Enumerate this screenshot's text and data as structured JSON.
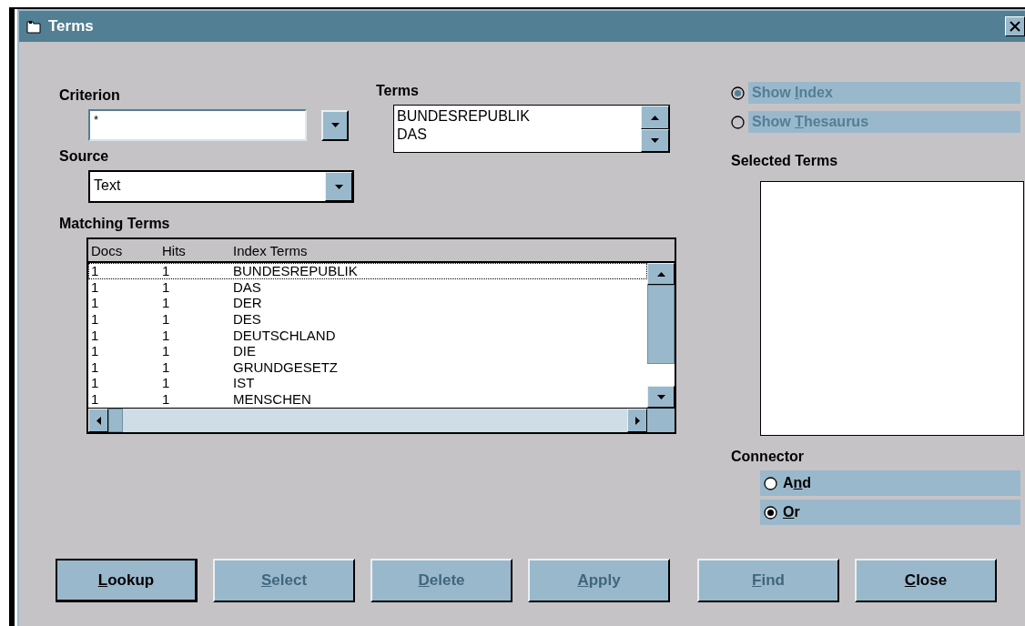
{
  "window": {
    "title": "Terms"
  },
  "criterion": {
    "label": "Criterion",
    "value": "*"
  },
  "terms": {
    "label": "Terms",
    "items": [
      "BUNDESREPUBLIK",
      "DAS"
    ]
  },
  "source": {
    "label": "Source",
    "value": "Text"
  },
  "matching_terms": {
    "label": "Matching Terms",
    "columns": [
      "Docs",
      "Hits",
      "Index Terms"
    ],
    "rows": [
      {
        "cells": [
          "1",
          "1",
          "BUNDESREPUBLIK"
        ],
        "focused": true
      },
      {
        "cells": [
          "1",
          "1",
          "DAS"
        ],
        "focused": false
      },
      {
        "cells": [
          "1",
          "1",
          "DER"
        ],
        "focused": false
      },
      {
        "cells": [
          "1",
          "1",
          "DES"
        ],
        "focused": false
      },
      {
        "cells": [
          "1",
          "1",
          "DEUTSCHLAND"
        ],
        "focused": false
      },
      {
        "cells": [
          "1",
          "1",
          "DIE"
        ],
        "focused": false
      },
      {
        "cells": [
          "1",
          "1",
          "GRUNDGESETZ"
        ],
        "focused": false
      },
      {
        "cells": [
          "1",
          "1",
          "IST"
        ],
        "focused": false
      },
      {
        "cells": [
          "1",
          "1",
          "MENSCHEN"
        ],
        "focused": false
      }
    ]
  },
  "view_options": [
    {
      "before": "Show ",
      "key": "I",
      "after": "ndex",
      "selected": true,
      "disabled": true
    },
    {
      "before": "Show ",
      "key": "T",
      "after": "hesaurus",
      "selected": false,
      "disabled": true
    }
  ],
  "selected_terms": {
    "label": "Selected Terms"
  },
  "connector": {
    "label": "Connector",
    "options": [
      {
        "before": "A",
        "key": "n",
        "after": "d",
        "selected": false,
        "disabled": false
      },
      {
        "key": "O",
        "after": "r",
        "selected": true,
        "disabled": false
      }
    ]
  },
  "buttons": [
    {
      "key": "L",
      "after": "ookup",
      "disabled": false
    },
    {
      "key": "S",
      "after": "elect",
      "disabled": true
    },
    {
      "key": "D",
      "after": "elete",
      "disabled": true
    },
    {
      "key": "A",
      "after": "pply",
      "disabled": true
    },
    {
      "key": "F",
      "after": "ind",
      "disabled": true
    },
    {
      "key": "C",
      "after": "lose",
      "disabled": false
    }
  ]
}
